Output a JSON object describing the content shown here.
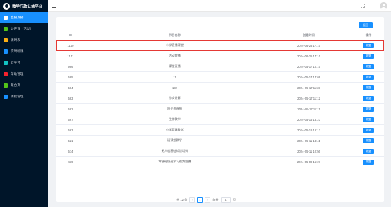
{
  "brand": {
    "title": "微学行政公益平台"
  },
  "sidebar": {
    "items": [
      {
        "label": "直播点播",
        "icon": "live-icon",
        "color": "#ffffff",
        "active": true
      },
      {
        "label": "公开课（活动）",
        "icon": "course-icon",
        "color": "#52c41a"
      },
      {
        "label": "课时表",
        "icon": "schedule-icon",
        "color": "#faad14"
      },
      {
        "label": "实时听课",
        "icon": "listen-icon",
        "color": "#1890ff"
      },
      {
        "label": "云平台",
        "icon": "cloud-icon",
        "color": "#13c2c2"
      },
      {
        "label": "帮助管理",
        "icon": "help-icon",
        "color": "#f5222d"
      },
      {
        "label": "聚合页",
        "icon": "aggregate-icon",
        "color": "#52c41a"
      },
      {
        "label": "课程管理",
        "icon": "graduation-cap-icon",
        "color": "#1890ff"
      }
    ]
  },
  "toolbar": {
    "back_label": "返回"
  },
  "table": {
    "headers": {
      "id": "ID",
      "name": "节目名称",
      "time": "创建时间",
      "op": "操作"
    },
    "rows": [
      {
        "id": "1140",
        "name": "小学直播课堂",
        "time": "2024-06-25 17:10",
        "op": "恢复"
      },
      {
        "id": "1141",
        "name": "活动审播",
        "time": "2024-06-25 17:10",
        "op": "恢复"
      },
      {
        "id": "986",
        "name": "课堂直播",
        "time": "2024-05-17 10:10",
        "op": "恢复"
      },
      {
        "id": "585",
        "name": "11",
        "time": "2024-05-17 14:09",
        "op": "恢复"
      },
      {
        "id": "584",
        "name": "132",
        "time": "2024-05-17 11:23",
        "op": "恢复"
      },
      {
        "id": "583",
        "name": "作文讲解",
        "time": "2024-05-17 11:12",
        "op": "恢复"
      },
      {
        "id": "582",
        "name": "阳光书直播",
        "time": "2024-05-17 11:11",
        "op": "恢复"
      },
      {
        "id": "567",
        "name": "生物教学",
        "time": "2024-05-16 16:23",
        "op": "恢复"
      },
      {
        "id": "563",
        "name": "小学篮球教学",
        "time": "2024-05-16 16:13",
        "op": "恢复"
      },
      {
        "id": "521",
        "name": "班课堂教学",
        "time": "2024-05-11 14:41",
        "op": "恢复"
      },
      {
        "id": "514",
        "name": "无人机基础知识培训",
        "time": "2024-05-11 10:56",
        "op": "恢复"
      },
      {
        "id": "439",
        "name": "零基础快速学习视频拍摄",
        "time": "2024-05-09 15:27",
        "op": "恢复"
      }
    ]
  },
  "pagination": {
    "total": "共 12 条",
    "prev": "‹",
    "current_page": "1",
    "next": "›",
    "goto_label": "前往",
    "goto_value": "1",
    "page_suffix": "页"
  }
}
